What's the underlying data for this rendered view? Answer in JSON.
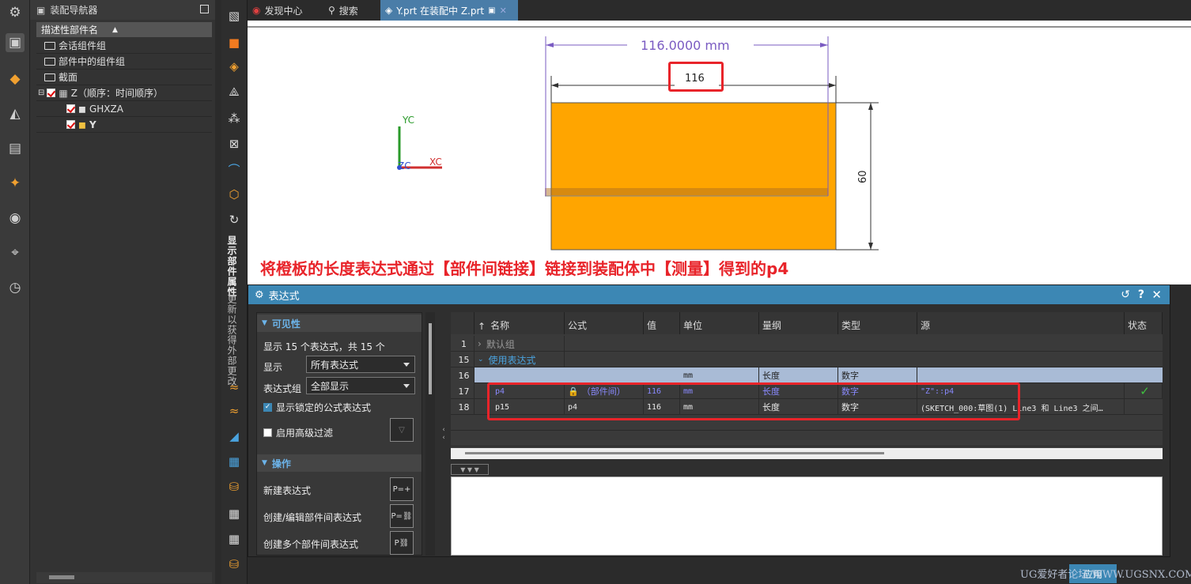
{
  "nav": {
    "title": "装配导航器",
    "column_header": "描述性部件名",
    "items": [
      {
        "label": "会话组件组"
      },
      {
        "label": "部件中的组件组"
      },
      {
        "label": "截面"
      },
      {
        "label": "Z（顺序：时间顺序）"
      },
      {
        "label": "GHXZA"
      },
      {
        "label": "Y"
      }
    ]
  },
  "side_vertical_labels": [
    "显示部件属性",
    "更新以获得外部更改"
  ],
  "tabs": [
    {
      "label": "发现中心"
    },
    {
      "label": "搜索"
    },
    {
      "label": "Y.prt 在装配中 Z.prt"
    }
  ],
  "canvas": {
    "dim_top": "116.0000 mm",
    "dim_inner": "116",
    "dim_side": "60",
    "axis_yc": "YC",
    "axis_xc": "XC",
    "axis_zc": "ZC",
    "annotation": "将橙板的长度表达式通过【部件间链接】链接到装配体中【测量】得到的p4",
    "plate_color": "#ffa500"
  },
  "dialog": {
    "title": "表达式",
    "visibility": {
      "header": "可见性",
      "summary": "显示 15 个表达式，共 15 个",
      "show_label": "显示",
      "show_value": "所有表达式",
      "group_label": "表达式组",
      "group_value": "全部显示",
      "locked_label": "显示锁定的公式表达式",
      "adv_filter_label": "启用高级过滤"
    },
    "operations": {
      "header": "操作",
      "new_expr": "新建表达式",
      "edit_interpart": "创建/编辑部件间表达式",
      "create_multi": "创建多个部件间表达式"
    },
    "grid": {
      "columns": [
        "名称",
        "公式",
        "值",
        "单位",
        "量纲",
        "类型",
        "源",
        "状态"
      ],
      "rows": [
        {
          "num": "1",
          "name": "默认组",
          "formula": "",
          "value": "",
          "unit": "",
          "dim": "",
          "type": "",
          "source": ""
        },
        {
          "num": "15",
          "name": "使用表达式",
          "formula": "",
          "value": "",
          "unit": "",
          "dim": "",
          "type": "",
          "source": ""
        },
        {
          "num": "16",
          "name": "",
          "formula": "",
          "value": "",
          "unit": "mm",
          "dim": "长度",
          "type": "数字",
          "source": ""
        },
        {
          "num": "17",
          "name": "p4",
          "formula": "（部件间）",
          "value": "116",
          "unit": "mm",
          "dim": "长度",
          "type": "数字",
          "source": "\"Z\"::p4"
        },
        {
          "num": "18",
          "name": "p15",
          "formula": "p4",
          "value": "116",
          "unit": "mm",
          "dim": "长度",
          "type": "数字",
          "source": "(SKETCH_000:草图(1) Line3 和 Line3 之间…"
        }
      ]
    }
  },
  "watermark": "UG爱好者论坛 WWW.UGSNX.COM",
  "apply_label": "应用"
}
